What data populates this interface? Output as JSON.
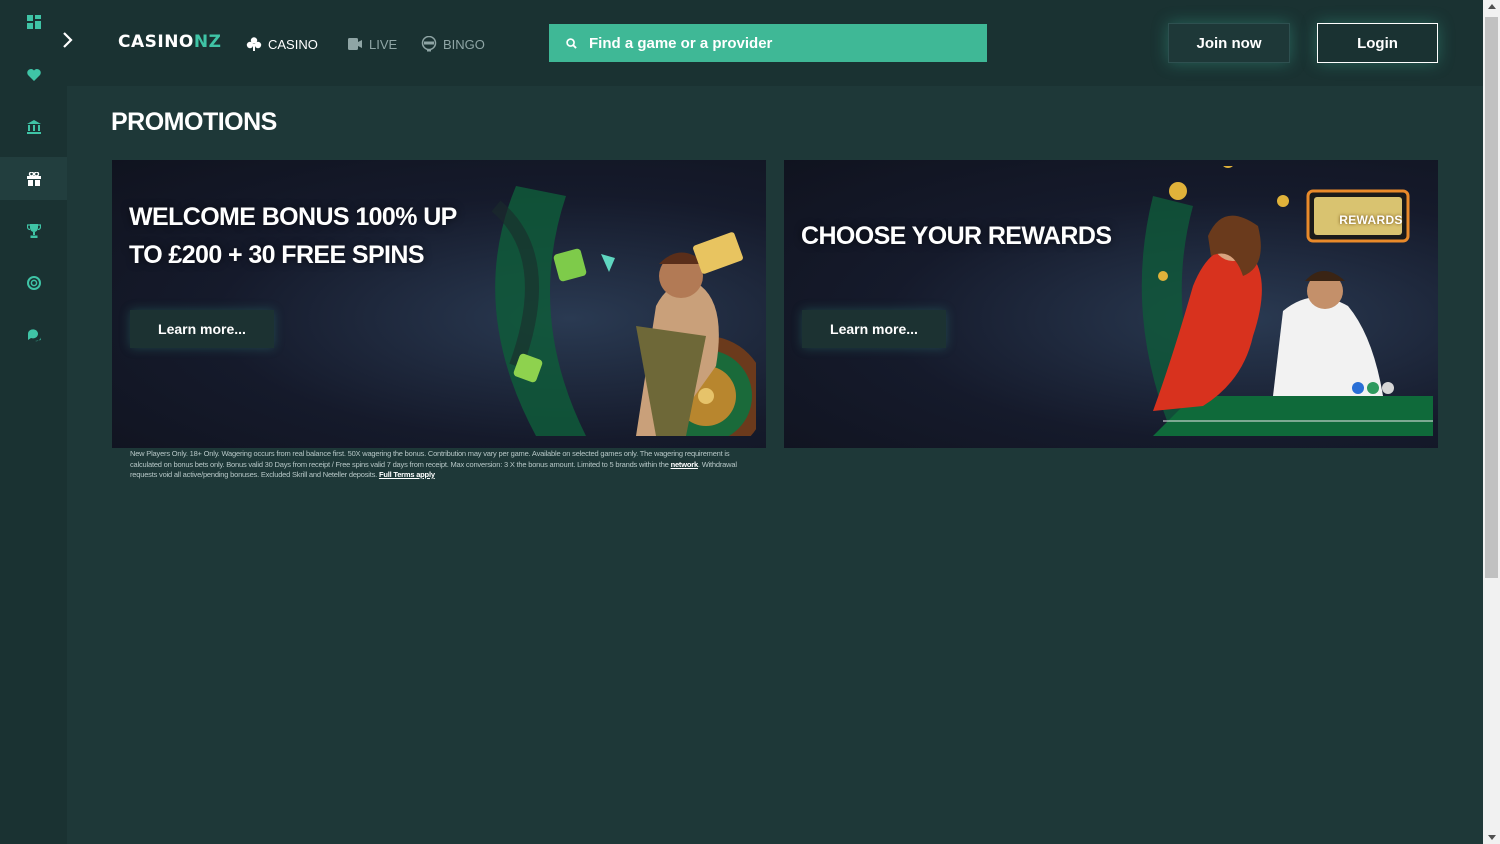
{
  "brand": {
    "logo_main": "CASINO",
    "logo_accent": "NZ",
    "accent": "#3fc4a6",
    "search_bg": "#3fb896",
    "page_bg": "#1e3838"
  },
  "sidebar": {
    "items": [
      {
        "icon": "grid-icon"
      },
      {
        "icon": "heart-icon"
      },
      {
        "icon": "bank-icon"
      },
      {
        "icon": "gift-icon",
        "active": true
      },
      {
        "icon": "trophy-icon"
      },
      {
        "icon": "support-icon"
      },
      {
        "icon": "chat-icon"
      }
    ]
  },
  "nav": {
    "casino": "CASINO",
    "live": "LIVE",
    "bingo": "BINGO"
  },
  "search": {
    "placeholder": "Find a game or a provider"
  },
  "header": {
    "join_label": "Join now",
    "login_label": "Login"
  },
  "page": {
    "title": "PROMOTIONS"
  },
  "promos": [
    {
      "headline": "WELCOME BONUS 100% UP TO £200 + 30 FREE SPINS",
      "button": "Learn more..."
    },
    {
      "headline": "CHOOSE YOUR REWARDS",
      "button": "Learn more...",
      "badge": "REWARDS"
    }
  ],
  "terms": {
    "text_1": "New Players Only. 18+ Only. Wagering occurs from real balance first. 50X wagering the bonus. Contribution may vary per game. Available on selected games only. The wagering requirement is calculated on bonus bets only. Bonus valid 30 Days from receipt / Free spins valid 7 days from receipt. Max conversion: 3 X the bonus amount. Limited to 5 brands within the ",
    "link_network": "network",
    "text_2": ". Withdrawal requests void all active/pending bonuses. Excluded Skrill and Neteller deposits. ",
    "link_full": "Full Terms apply"
  }
}
